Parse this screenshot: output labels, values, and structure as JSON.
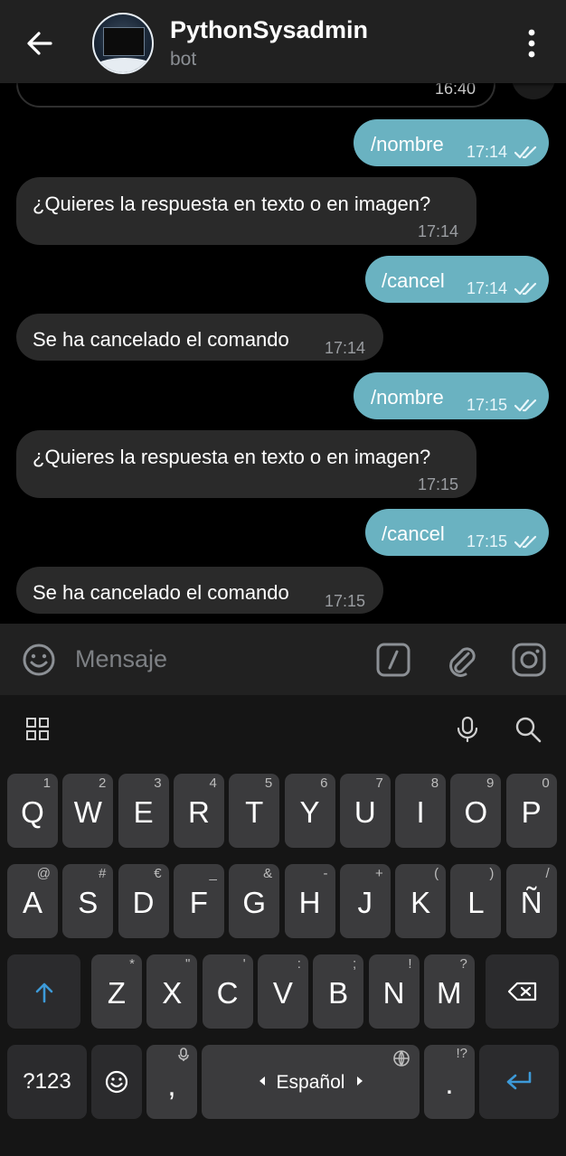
{
  "header": {
    "title": "PythonSysadmin",
    "subtitle": "bot"
  },
  "chat": {
    "partial_time": "16:40",
    "messages": [
      {
        "dir": "out",
        "text": "/nombre",
        "time": "17:14"
      },
      {
        "dir": "in",
        "text": "¿Quieres la respuesta en texto o en imagen?",
        "time": "17:14"
      },
      {
        "dir": "out",
        "text": "/cancel",
        "time": "17:14"
      },
      {
        "dir": "in",
        "text": "Se ha cancelado el comando",
        "time": "17:14"
      },
      {
        "dir": "out",
        "text": "/nombre",
        "time": "17:15"
      },
      {
        "dir": "in",
        "text": "¿Quieres la respuesta en texto o en imagen?",
        "time": "17:15"
      },
      {
        "dir": "out",
        "text": "/cancel",
        "time": "17:15"
      },
      {
        "dir": "in",
        "text": "Se ha cancelado el comando",
        "time": "17:15"
      }
    ]
  },
  "input": {
    "placeholder": "Mensaje"
  },
  "keyboard": {
    "row1": [
      {
        "k": "Q",
        "h": "1"
      },
      {
        "k": "W",
        "h": "2"
      },
      {
        "k": "E",
        "h": "3"
      },
      {
        "k": "R",
        "h": "4"
      },
      {
        "k": "T",
        "h": "5"
      },
      {
        "k": "Y",
        "h": "6"
      },
      {
        "k": "U",
        "h": "7"
      },
      {
        "k": "I",
        "h": "8"
      },
      {
        "k": "O",
        "h": "9"
      },
      {
        "k": "P",
        "h": "0"
      }
    ],
    "row2": [
      {
        "k": "A",
        "h": "@"
      },
      {
        "k": "S",
        "h": "#"
      },
      {
        "k": "D",
        "h": "€"
      },
      {
        "k": "F",
        "h": "_"
      },
      {
        "k": "G",
        "h": "&"
      },
      {
        "k": "H",
        "h": "-"
      },
      {
        "k": "J",
        "h": "+"
      },
      {
        "k": "K",
        "h": "("
      },
      {
        "k": "L",
        "h": ")"
      },
      {
        "k": "Ñ",
        "h": "/"
      }
    ],
    "row3": [
      {
        "k": "Z",
        "h": "*"
      },
      {
        "k": "X",
        "h": "\""
      },
      {
        "k": "C",
        "h": "'"
      },
      {
        "k": "V",
        "h": ":"
      },
      {
        "k": "B",
        "h": ";"
      },
      {
        "k": "N",
        "h": "!"
      },
      {
        "k": "M",
        "h": "?"
      }
    ],
    "symbols_label": "?123",
    "comma": ",",
    "space_label": "Español",
    "period": ".",
    "period_hint": "!?"
  },
  "colors": {
    "outgoing": "#6ab2c1",
    "incoming": "#2a2a2a",
    "accent": "#3d9ad8"
  }
}
